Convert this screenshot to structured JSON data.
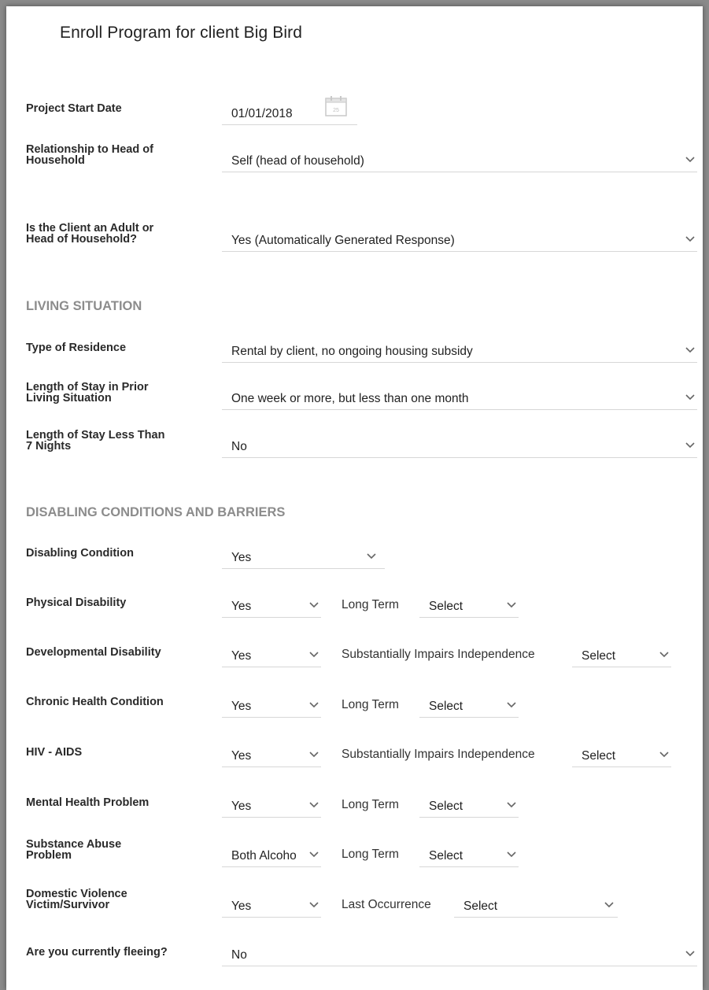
{
  "title": "Enroll Program for client Big Bird",
  "project_start": {
    "label": "Project Start Date",
    "value": "01/01/2018"
  },
  "relationship": {
    "label_line1": "Relationship to Head of",
    "label_line2": "Household",
    "value": "Self (head of household)"
  },
  "adult": {
    "label_line1": "Is the Client an Adult or",
    "label_line2": "Head of Household?",
    "value": "Yes (Automatically Generated Response)"
  },
  "living_situation": {
    "heading": "LIVING SITUATION",
    "residence": {
      "label": "Type of Residence",
      "value": "Rental by client, no ongoing housing subsidy"
    },
    "length_stay": {
      "label_line1": "Length of Stay in Prior",
      "label_line2": "Living Situation",
      "value": "One week or more, but less than one month"
    },
    "less_7": {
      "label_line1": "Length of Stay Less Than",
      "label_line2": "7 Nights",
      "value": "No"
    }
  },
  "disabling": {
    "heading": "DISABLING CONDITIONS AND BARRIERS",
    "condition": {
      "label": "Disabling Condition",
      "value": "Yes"
    },
    "physical": {
      "label": "Physical Disability",
      "value": "Yes",
      "sub_label": "Long Term",
      "sub_value": "Select"
    },
    "developmental": {
      "label": "Developmental Disability",
      "value": "Yes",
      "sub_label": "Substantially Impairs Independence",
      "sub_value": "Select"
    },
    "chronic": {
      "label": "Chronic Health Condition",
      "value": "Yes",
      "sub_label": "Long Term",
      "sub_value": "Select"
    },
    "hiv": {
      "label": "HIV - AIDS",
      "value": "Yes",
      "sub_label": "Substantially Impairs Independence",
      "sub_value": "Select"
    },
    "mental": {
      "label": "Mental Health Problem",
      "value": "Yes",
      "sub_label": "Long Term",
      "sub_value": "Select"
    },
    "substance": {
      "label_line1": "Substance Abuse",
      "label_line2": "Problem",
      "value": "Both Alcoho",
      "sub_label": "Long Term",
      "sub_value": "Select"
    },
    "domestic": {
      "label_line1": "Domestic Violence",
      "label_line2": "Victim/Survivor",
      "value": "Yes",
      "sub_label": "Last Occurrence",
      "sub_value": "Select"
    },
    "fleeing": {
      "label": "Are you currently fleeing?",
      "value": "No"
    }
  },
  "icons": {
    "dropdown": "chevron-down-icon",
    "date": "calendar-icon"
  }
}
